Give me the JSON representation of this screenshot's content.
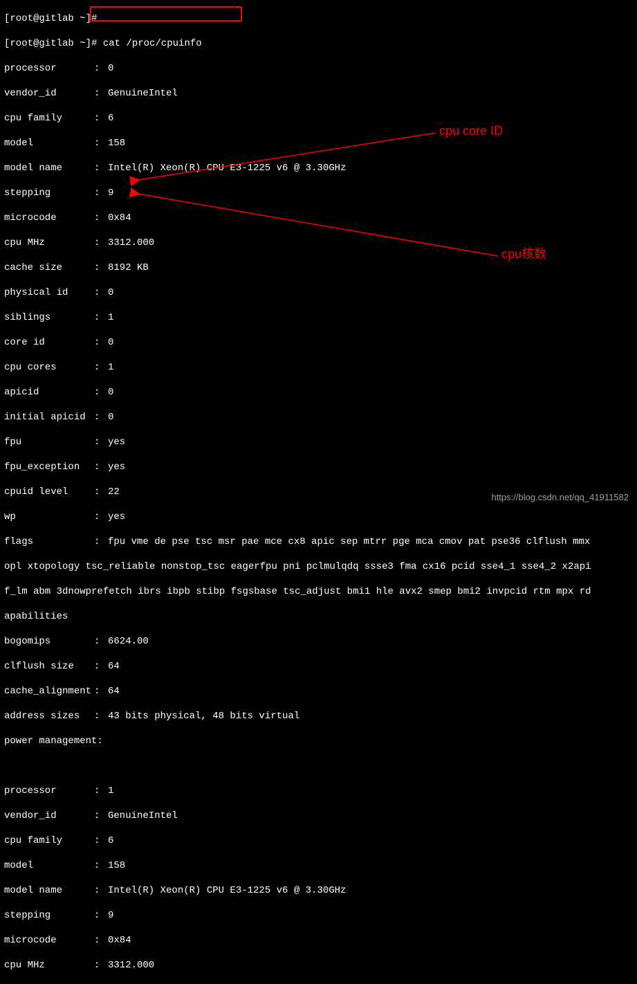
{
  "prompt0": "[root@gitlab ~]#",
  "cmd_line_prefix": "[root@gitlab ~]# ",
  "command": "cat /proc/cpuinfo",
  "cpu0": {
    "processor": "0",
    "vendor_id": "GenuineIntel",
    "cpu_family": "6",
    "model": "158",
    "model_name": "Intel(R) Xeon(R) CPU E3-1225 v6 @ 3.30GHz",
    "stepping": "9",
    "microcode": "0x84",
    "cpu_mhz": "3312.000",
    "cache_size": "8192 KB",
    "physical_id": "0",
    "siblings": "1",
    "core_id": "0",
    "cpu_cores": "1",
    "apicid": "0",
    "initial_apicid": "0",
    "fpu": "yes",
    "fpu_exception": "yes",
    "cpuid_level": "22",
    "wp": "yes",
    "flags_l1": "fpu vme de pse tsc msr pae mce cx8 apic sep mtrr pge mca cmov pat pse36 clflush mmx",
    "flags_l2": "opl xtopology tsc_reliable nonstop_tsc eagerfpu pni pclmulqdq ssse3 fma cx16 pcid sse4_1 sse4_2 x2api",
    "flags_l3": "f_lm abm 3dnowprefetch ibrs ibpb stibp fsgsbase tsc_adjust bmi1 hle avx2 smep bmi2 invpcid rtm mpx rd",
    "flags_l4": "apabilities",
    "bogomips": "6624.00",
    "clflush_size": "64",
    "cache_alignment": "64",
    "address_sizes": "43 bits physical, 48 bits virtual",
    "power_management": ""
  },
  "cpu1": {
    "processor": "1",
    "vendor_id": "GenuineIntel",
    "cpu_family": "6",
    "model": "158",
    "model_name": "Intel(R) Xeon(R) CPU E3-1225 v6 @ 3.30GHz",
    "stepping": "9",
    "microcode": "0x84",
    "cpu_mhz": "3312.000"
  },
  "labels": {
    "processor": "processor",
    "vendor_id": "vendor_id",
    "cpu_family": "cpu family",
    "model": "model",
    "model_name": "model name",
    "stepping": "stepping",
    "microcode": "microcode",
    "cpu_mhz": "cpu MHz",
    "cache_size": "cache size",
    "physical_id": "physical id",
    "siblings": "siblings",
    "core_id": "core id",
    "cpu_cores": "cpu cores",
    "apicid": "apicid",
    "initial_apicid": "initial apicid",
    "fpu": "fpu",
    "fpu_exception": "fpu_exception",
    "cpuid_level": "cpuid level",
    "wp": "wp",
    "flags": "flags",
    "bogomips": "bogomips",
    "clflush_size": "clflush size",
    "cache_alignment": "cache_alignment",
    "address_sizes": "address sizes",
    "power_management": "power management:"
  },
  "annotations": {
    "core_id": "cpu core ID",
    "cpu_cores": "cpu核数"
  },
  "watermark": "https://blog.csdn.net/qq_41911582"
}
